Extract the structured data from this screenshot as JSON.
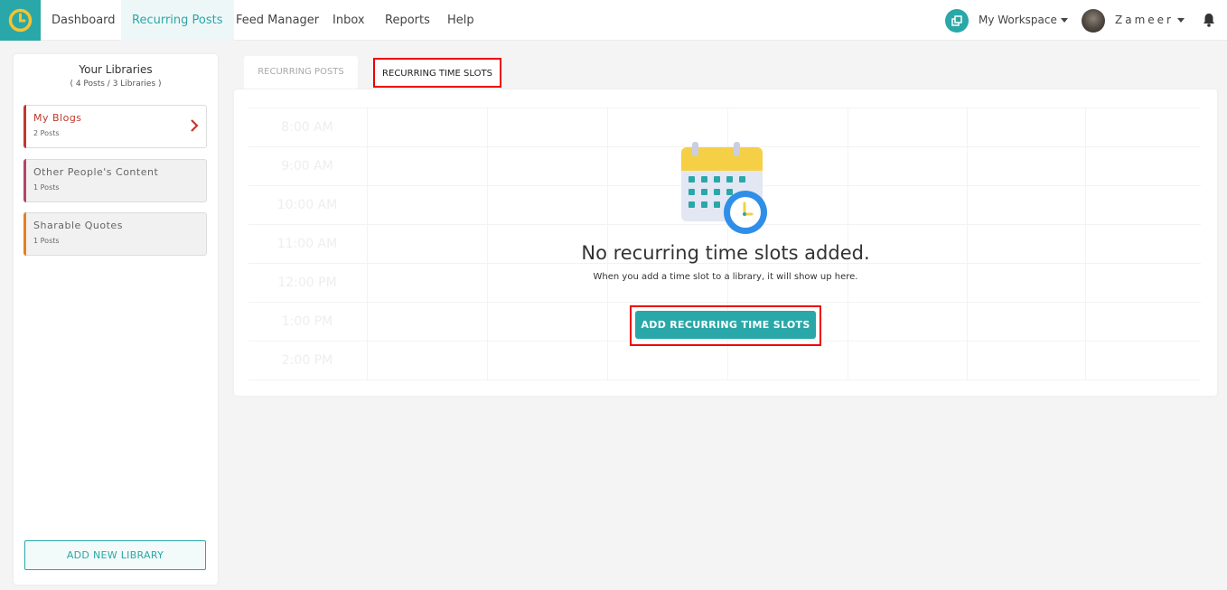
{
  "nav": {
    "items": [
      {
        "label": "Dashboard"
      },
      {
        "label": "Recurring Posts"
      },
      {
        "label": "Feed Manager"
      },
      {
        "label": "Inbox"
      },
      {
        "label": "Reports"
      },
      {
        "label": "Help"
      }
    ],
    "active": "Recurring Posts",
    "workspace": "My Workspace",
    "user": "Zameer"
  },
  "sidebar": {
    "title": "Your Libraries",
    "subtitle": "( 4 Posts / 3 Libraries )",
    "libraries": [
      {
        "name": "My Blogs",
        "count": "2 Posts",
        "color": "#c0392b"
      },
      {
        "name": "Other People's Content",
        "count": "1 Posts",
        "color": "#b0456a"
      },
      {
        "name": "Sharable Quotes",
        "count": "1 Posts",
        "color": "#e67e22"
      }
    ],
    "add_button": "ADD NEW LIBRARY"
  },
  "tabs": [
    {
      "label": "RECURRING POSTS"
    },
    {
      "label": "RECURRING TIME SLOTS"
    }
  ],
  "active_tab": "RECURRING TIME SLOTS",
  "schedule": {
    "times": [
      "8:00 AM",
      "9:00 AM",
      "10:00 AM",
      "11:00 AM",
      "12:00 PM",
      "1:00 PM",
      "2:00 PM"
    ]
  },
  "empty_state": {
    "title": "No recurring time slots added.",
    "subtitle": "When you add a time slot to a library, it will show up here.",
    "button": "ADD RECURRING TIME SLOTS"
  },
  "colors": {
    "accent": "#2aa7a8",
    "highlight": "#ee0000"
  }
}
